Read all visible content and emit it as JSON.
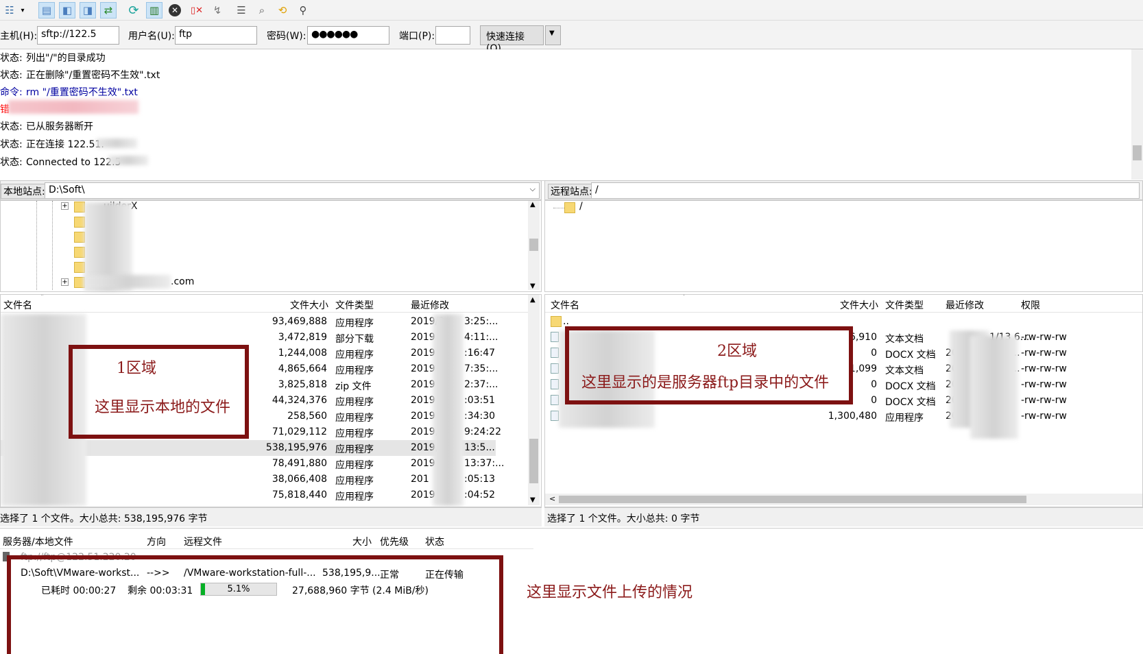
{
  "toolbar": {
    "icons": [
      "site-manager-icon",
      "dropdown-icon",
      "message-log-icon",
      "local-tree-icon",
      "remote-tree-icon",
      "transfer-queue-icon",
      "refresh-icon",
      "process-queue-icon",
      "cancel-icon",
      "disconnect-icon",
      "reconnect-icon",
      "directory-listing-filters-icon",
      "compare-icon",
      "sync-browse-icon",
      "search-icon"
    ]
  },
  "quickconnect": {
    "host_label": "主机(H):",
    "host_value": "sftp://122.5",
    "user_label": "用户名(U):",
    "user_value": "ftp",
    "pass_label": "密码(W):",
    "pass_value": "●●●●●●",
    "port_label": "端口(P):",
    "port_value": "",
    "connect_button": "快速连接(Q)",
    "dropdown_glyph": "▼"
  },
  "log": [
    {
      "label": "状态:",
      "text": "列出\"/\"的目录成功",
      "color": "#000000"
    },
    {
      "label": "状态:",
      "text": "正在删除\"/重置密码不生效\".txt",
      "color": "#000000"
    },
    {
      "label": "命令:",
      "text": "rm \"/重置密码不生效\".txt",
      "color": "#0000a0"
    },
    {
      "label": "错",
      "text": "",
      "color": "#ff0000"
    },
    {
      "label": "状态:",
      "text": "已从服务器断开",
      "color": "#000000"
    },
    {
      "label": "状态:",
      "text": "正在连接 122.51.",
      "color": "#000000"
    },
    {
      "label": "状态:",
      "text": "Connected to 122.5",
      "color": "#000000"
    }
  ],
  "local": {
    "path_label": "本地站点:",
    "path_value": "D:\\Soft\\",
    "tree_items": [
      "uilderX",
      ".com"
    ],
    "columns": {
      "name": "文件名",
      "size": "文件大小",
      "type": "文件类型",
      "modified": "最近修改"
    },
    "files": [
      {
        "size": "93,469,888",
        "type": "应用程序",
        "date": "2019/3",
        "time": "3:25:..."
      },
      {
        "size": "3,472,819",
        "type": "部分下载",
        "date": "2019",
        "time": "4:11:..."
      },
      {
        "size": "1,244,008",
        "type": "应用程序",
        "date": "2019",
        "time": ":16:47"
      },
      {
        "size": "4,865,664",
        "type": "应用程序",
        "date": "2019",
        "time": "7:35:..."
      },
      {
        "size": "3,825,818",
        "type": "zip 文件",
        "date": "2019",
        "time": "2:37:..."
      },
      {
        "size": "44,324,376",
        "type": "应用程序",
        "date": "2019",
        "time": ":03:51"
      },
      {
        "size": "258,560",
        "type": "应用程序",
        "date": "2019",
        "time": ":34:30"
      },
      {
        "size": "71,029,112",
        "type": "应用程序",
        "date": "2019,",
        "time": "9:24:22"
      },
      {
        "size": "538,195,976",
        "type": "应用程序",
        "date": "2019,",
        "time": "13:5..."
      },
      {
        "size": "78,491,880",
        "type": "应用程序",
        "date": "2019",
        "time": "13:37:..."
      },
      {
        "size": "38,066,408",
        "type": "应用程序",
        "date": "201",
        "time": ":05:13"
      },
      {
        "size": "75,818,440",
        "type": "应用程序",
        "date": "2019",
        "time": ":04:52"
      }
    ],
    "selected_index": 8,
    "status": "选择了 1 个文件。大小总共: 538,195,976 字节"
  },
  "remote": {
    "path_label": "远程站点:",
    "path_value": "/",
    "tree_items": [
      "/"
    ],
    "columns": {
      "name": "文件名",
      "size": "文件大小",
      "type": "文件类型",
      "modified": "最近修改",
      "perm": "权限"
    },
    "parent_entry": "..",
    "files": [
      {
        "size": "6,910",
        "type": "文本文档",
        "date": "",
        "time": "1/13 6...",
        "perm": "-rw-rw-rw"
      },
      {
        "size": "0",
        "type": "DOCX 文档",
        "date": "20",
        "time": "13 6...",
        "perm": "-rw-rw-rw"
      },
      {
        "size": "1,099",
        "type": "文本文档",
        "date": "201",
        "time": "13 6...",
        "perm": "-rw-rw-rw"
      },
      {
        "size": "0",
        "type": "DOCX 文档",
        "date": "2019",
        "time": "3 6...",
        "perm": "-rw-rw-rw"
      },
      {
        "size": "0",
        "type": "DOCX 文档",
        "date": "2019",
        "time": "3 6...",
        "perm": "-rw-rw-rw"
      },
      {
        "size": "1,300,480",
        "type": "应用程序",
        "date": "2019",
        "time": "3 6...",
        "perm": "-rw-rw-rw"
      }
    ],
    "status": "选择了 1 个文件。大小总共: 0 字节"
  },
  "queue": {
    "columns": {
      "local": "服务器/本地文件",
      "dir": "方向",
      "remote": "远程文件",
      "size": "大小",
      "priority": "优先级",
      "status": "状态"
    },
    "server": "ftp://ftp@122.51.220.20",
    "transfer": {
      "local": "D:\\Soft\\VMware-workst...",
      "dir": "-->>",
      "remote": "/VMware-workstation-full-...",
      "size": "538,195,9...",
      "priority": "正常",
      "status": "正在传输",
      "elapsed": "已耗时 00:00:27",
      "remaining": "剩余 00:03:31",
      "progress_label": "5.1%",
      "progress": 0.051,
      "bytes": "27,688,960 字节 (2.4 MiB/秒)"
    }
  },
  "annotations": {
    "area1_title": "1区域",
    "area1_text": "这里显示本地的文件",
    "area2_title": "2区域",
    "area2_text": "这里显示的是服务器ftp目录中的文件",
    "upload_text": "这里显示文件上传的情况"
  },
  "colors": {
    "annotation": "#8b1a1a",
    "progress": "#06b025",
    "selection": "#e5e5e5"
  }
}
